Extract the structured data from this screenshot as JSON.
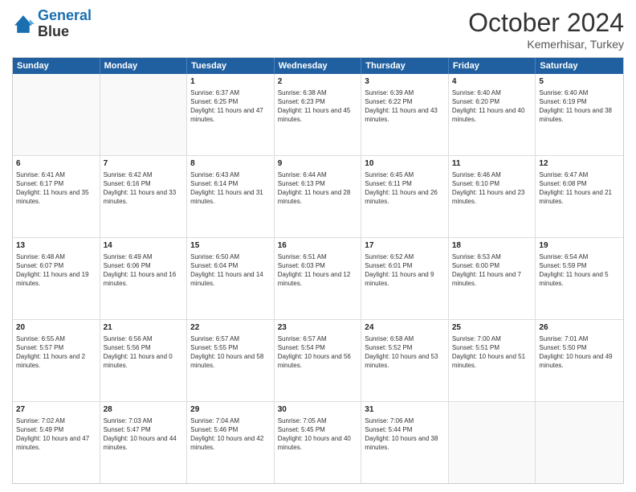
{
  "header": {
    "logo_line1": "General",
    "logo_line2": "Blue",
    "title": "October 2024",
    "location": "Kemerhisar, Turkey"
  },
  "days_of_week": [
    "Sunday",
    "Monday",
    "Tuesday",
    "Wednesday",
    "Thursday",
    "Friday",
    "Saturday"
  ],
  "weeks": [
    [
      {
        "day": "",
        "empty": true
      },
      {
        "day": "",
        "empty": true
      },
      {
        "day": "1",
        "sunrise": "Sunrise: 6:37 AM",
        "sunset": "Sunset: 6:25 PM",
        "daylight": "Daylight: 11 hours and 47 minutes."
      },
      {
        "day": "2",
        "sunrise": "Sunrise: 6:38 AM",
        "sunset": "Sunset: 6:23 PM",
        "daylight": "Daylight: 11 hours and 45 minutes."
      },
      {
        "day": "3",
        "sunrise": "Sunrise: 6:39 AM",
        "sunset": "Sunset: 6:22 PM",
        "daylight": "Daylight: 11 hours and 43 minutes."
      },
      {
        "day": "4",
        "sunrise": "Sunrise: 6:40 AM",
        "sunset": "Sunset: 6:20 PM",
        "daylight": "Daylight: 11 hours and 40 minutes."
      },
      {
        "day": "5",
        "sunrise": "Sunrise: 6:40 AM",
        "sunset": "Sunset: 6:19 PM",
        "daylight": "Daylight: 11 hours and 38 minutes."
      }
    ],
    [
      {
        "day": "6",
        "sunrise": "Sunrise: 6:41 AM",
        "sunset": "Sunset: 6:17 PM",
        "daylight": "Daylight: 11 hours and 35 minutes."
      },
      {
        "day": "7",
        "sunrise": "Sunrise: 6:42 AM",
        "sunset": "Sunset: 6:16 PM",
        "daylight": "Daylight: 11 hours and 33 minutes."
      },
      {
        "day": "8",
        "sunrise": "Sunrise: 6:43 AM",
        "sunset": "Sunset: 6:14 PM",
        "daylight": "Daylight: 11 hours and 31 minutes."
      },
      {
        "day": "9",
        "sunrise": "Sunrise: 6:44 AM",
        "sunset": "Sunset: 6:13 PM",
        "daylight": "Daylight: 11 hours and 28 minutes."
      },
      {
        "day": "10",
        "sunrise": "Sunrise: 6:45 AM",
        "sunset": "Sunset: 6:11 PM",
        "daylight": "Daylight: 11 hours and 26 minutes."
      },
      {
        "day": "11",
        "sunrise": "Sunrise: 6:46 AM",
        "sunset": "Sunset: 6:10 PM",
        "daylight": "Daylight: 11 hours and 23 minutes."
      },
      {
        "day": "12",
        "sunrise": "Sunrise: 6:47 AM",
        "sunset": "Sunset: 6:08 PM",
        "daylight": "Daylight: 11 hours and 21 minutes."
      }
    ],
    [
      {
        "day": "13",
        "sunrise": "Sunrise: 6:48 AM",
        "sunset": "Sunset: 6:07 PM",
        "daylight": "Daylight: 11 hours and 19 minutes."
      },
      {
        "day": "14",
        "sunrise": "Sunrise: 6:49 AM",
        "sunset": "Sunset: 6:06 PM",
        "daylight": "Daylight: 11 hours and 16 minutes."
      },
      {
        "day": "15",
        "sunrise": "Sunrise: 6:50 AM",
        "sunset": "Sunset: 6:04 PM",
        "daylight": "Daylight: 11 hours and 14 minutes."
      },
      {
        "day": "16",
        "sunrise": "Sunrise: 6:51 AM",
        "sunset": "Sunset: 6:03 PM",
        "daylight": "Daylight: 11 hours and 12 minutes."
      },
      {
        "day": "17",
        "sunrise": "Sunrise: 6:52 AM",
        "sunset": "Sunset: 6:01 PM",
        "daylight": "Daylight: 11 hours and 9 minutes."
      },
      {
        "day": "18",
        "sunrise": "Sunrise: 6:53 AM",
        "sunset": "Sunset: 6:00 PM",
        "daylight": "Daylight: 11 hours and 7 minutes."
      },
      {
        "day": "19",
        "sunrise": "Sunrise: 6:54 AM",
        "sunset": "Sunset: 5:59 PM",
        "daylight": "Daylight: 11 hours and 5 minutes."
      }
    ],
    [
      {
        "day": "20",
        "sunrise": "Sunrise: 6:55 AM",
        "sunset": "Sunset: 5:57 PM",
        "daylight": "Daylight: 11 hours and 2 minutes."
      },
      {
        "day": "21",
        "sunrise": "Sunrise: 6:56 AM",
        "sunset": "Sunset: 5:56 PM",
        "daylight": "Daylight: 11 hours and 0 minutes."
      },
      {
        "day": "22",
        "sunrise": "Sunrise: 6:57 AM",
        "sunset": "Sunset: 5:55 PM",
        "daylight": "Daylight: 10 hours and 58 minutes."
      },
      {
        "day": "23",
        "sunrise": "Sunrise: 6:57 AM",
        "sunset": "Sunset: 5:54 PM",
        "daylight": "Daylight: 10 hours and 56 minutes."
      },
      {
        "day": "24",
        "sunrise": "Sunrise: 6:58 AM",
        "sunset": "Sunset: 5:52 PM",
        "daylight": "Daylight: 10 hours and 53 minutes."
      },
      {
        "day": "25",
        "sunrise": "Sunrise: 7:00 AM",
        "sunset": "Sunset: 5:51 PM",
        "daylight": "Daylight: 10 hours and 51 minutes."
      },
      {
        "day": "26",
        "sunrise": "Sunrise: 7:01 AM",
        "sunset": "Sunset: 5:50 PM",
        "daylight": "Daylight: 10 hours and 49 minutes."
      }
    ],
    [
      {
        "day": "27",
        "sunrise": "Sunrise: 7:02 AM",
        "sunset": "Sunset: 5:49 PM",
        "daylight": "Daylight: 10 hours and 47 minutes."
      },
      {
        "day": "28",
        "sunrise": "Sunrise: 7:03 AM",
        "sunset": "Sunset: 5:47 PM",
        "daylight": "Daylight: 10 hours and 44 minutes."
      },
      {
        "day": "29",
        "sunrise": "Sunrise: 7:04 AM",
        "sunset": "Sunset: 5:46 PM",
        "daylight": "Daylight: 10 hours and 42 minutes."
      },
      {
        "day": "30",
        "sunrise": "Sunrise: 7:05 AM",
        "sunset": "Sunset: 5:45 PM",
        "daylight": "Daylight: 10 hours and 40 minutes."
      },
      {
        "day": "31",
        "sunrise": "Sunrise: 7:06 AM",
        "sunset": "Sunset: 5:44 PM",
        "daylight": "Daylight: 10 hours and 38 minutes."
      },
      {
        "day": "",
        "empty": true
      },
      {
        "day": "",
        "empty": true
      }
    ]
  ]
}
